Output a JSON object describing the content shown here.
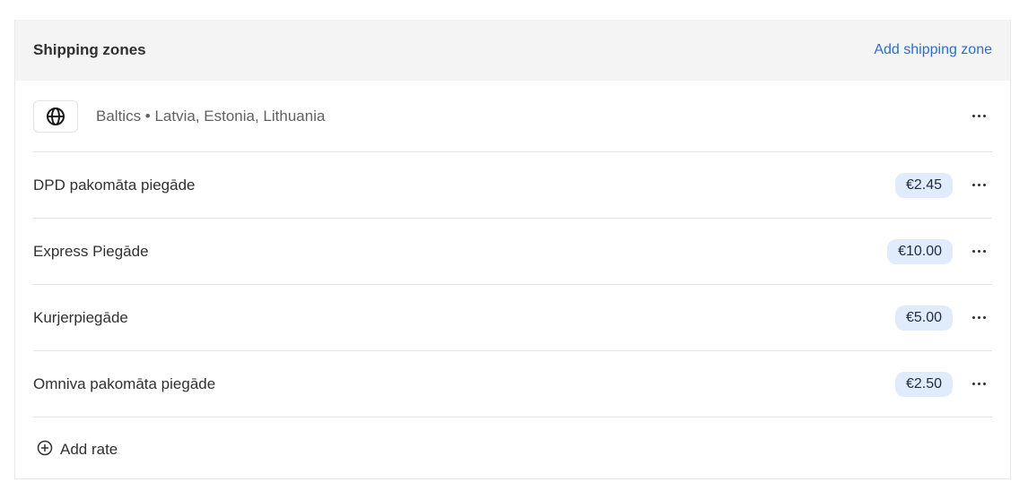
{
  "card": {
    "title": "Shipping zones",
    "add_zone_label": "Add shipping zone"
  },
  "zone": {
    "icon": "globe-icon",
    "label": "Baltics • Latvia, Estonia, Lithuania"
  },
  "rates": [
    {
      "name": "DPD pakomāta piegāde",
      "price": "€2.45"
    },
    {
      "name": "Express Piegāde",
      "price": "€10.00"
    },
    {
      "name": "Kurjerpiegāde",
      "price": "€5.00"
    },
    {
      "name": "Omniva pakomāta piegāde",
      "price": "€2.50"
    }
  ],
  "add_rate_label": "Add rate",
  "colors": {
    "link": "#2c6ecb",
    "header_bg": "#f4f4f4",
    "price_badge_bg": "#e0ecfb"
  }
}
